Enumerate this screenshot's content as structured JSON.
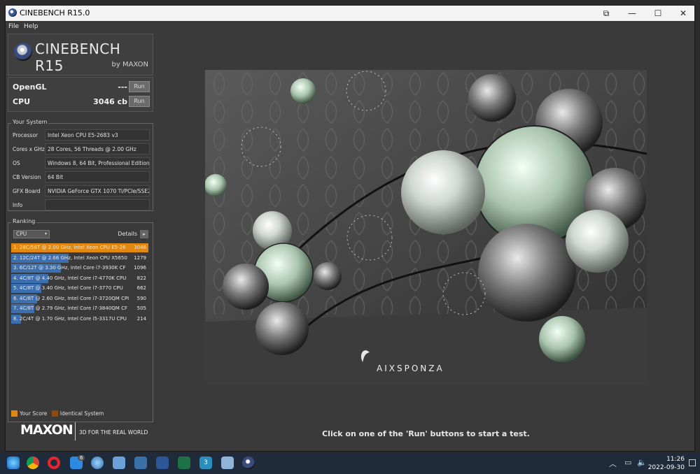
{
  "window": {
    "title": "CINEBENCH R15.0",
    "restore_glyph": "⧉",
    "minimize_glyph": "—",
    "maximize_glyph": "☐",
    "close_glyph": "✕"
  },
  "menu": {
    "file": "File",
    "help": "Help"
  },
  "logo": {
    "name": "CINEBENCH R15",
    "by": "by MAXON"
  },
  "scores": {
    "opengl_label": "OpenGL",
    "opengl_value": "---",
    "cpu_label": "CPU",
    "cpu_value": "3046 cb",
    "run_label": "Run"
  },
  "system": {
    "title": "Your System",
    "rows": [
      {
        "key": "Processor",
        "value": "Intel Xeon CPU E5-2683 v3"
      },
      {
        "key": "Cores x GHz",
        "value": "28 Cores, 56 Threads @ 2.00 GHz"
      },
      {
        "key": "OS",
        "value": "Windows 8, 64 Bit, Professional Edition"
      },
      {
        "key": "CB Version",
        "value": "64 Bit"
      },
      {
        "key": "GFX Board",
        "value": "NVIDIA GeForce GTX 1070 Ti/PCIe/SSE2"
      },
      {
        "key": "Info",
        "value": ""
      }
    ]
  },
  "ranking": {
    "title": "Ranking",
    "select_value": "CPU",
    "details_label": "Details",
    "details_glyph": "▸",
    "select_glyph": "▾",
    "rows": [
      {
        "text": "1. 28C/56T @ 2.00 GHz, Intel Xeon CPU E5-26",
        "score": "3046",
        "fraction": 1.0
      },
      {
        "text": "2. 12C/24T @ 2.66 GHz, Intel Xeon CPU X5650",
        "score": "1279",
        "fraction": 0.42
      },
      {
        "text": "3. 6C/12T @ 3.30 GHz, Intel Core i7-3930K CF",
        "score": "1096",
        "fraction": 0.36
      },
      {
        "text": "4. 4C/8T @ 4.40 GHz, Intel Core i7-4770K CPU",
        "score": "822",
        "fraction": 0.27
      },
      {
        "text": "5. 4C/8T @ 3.40 GHz, Intel Core i7-3770 CPU",
        "score": "662",
        "fraction": 0.22
      },
      {
        "text": "6. 4C/8T @ 2.60 GHz, Intel Core i7-3720QM CPI",
        "score": "590",
        "fraction": 0.19
      },
      {
        "text": "7. 4C/8T @ 2.79 GHz, Intel Core i7-3840QM CF",
        "score": "505",
        "fraction": 0.17
      },
      {
        "text": "8. 2C/4T @ 1.70 GHz, Intel Core i5-3317U CPU",
        "score": "214",
        "fraction": 0.07
      }
    ],
    "legend_your_score": "Your Score",
    "legend_identical": "Identical System"
  },
  "footer": {
    "brand": "MAXON",
    "tagline": "3D FOR THE REAL WORLD"
  },
  "render": {
    "watermark": "AIXSPONZA"
  },
  "status_text": "Click on one of the 'Run' buttons to start a test.",
  "taskbar": {
    "mail_badge": "6",
    "date_badge": "3",
    "time": "11:26",
    "date": "2022-09-30"
  },
  "colors": {
    "your_score": "#e0880f",
    "identical": "#8a4a10",
    "rank_bar": "#3b6fb0"
  }
}
